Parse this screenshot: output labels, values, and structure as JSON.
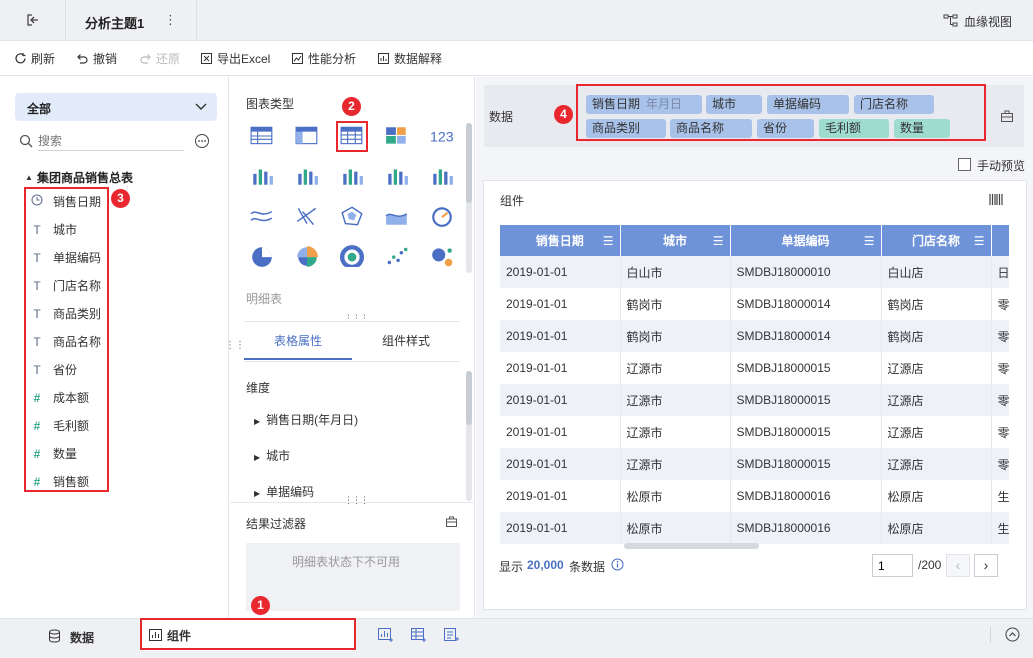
{
  "topbar": {
    "back_icon": "exit-icon",
    "title": "分析主题1",
    "more": "⋮",
    "lineage_label": "血缘视图"
  },
  "toolbar": {
    "refresh": "刷新",
    "undo": "撤销",
    "redo": "还原",
    "export_excel": "导出Excel",
    "perf": "性能分析",
    "explain": "数据解释"
  },
  "left": {
    "dropdown": "全部",
    "search_placeholder": "搜索",
    "table_name": "集团商品销售总表",
    "fields": [
      {
        "label": "销售日期",
        "type": "date"
      },
      {
        "label": "城市",
        "type": "text"
      },
      {
        "label": "单据编码",
        "type": "text"
      },
      {
        "label": "门店名称",
        "type": "text"
      },
      {
        "label": "商品类别",
        "type": "text"
      },
      {
        "label": "商品名称",
        "type": "text"
      },
      {
        "label": "省份",
        "type": "text"
      },
      {
        "label": "成本额",
        "type": "number"
      },
      {
        "label": "毛利额",
        "type": "number"
      },
      {
        "label": "数量",
        "type": "number"
      },
      {
        "label": "销售额",
        "type": "number"
      }
    ]
  },
  "mid": {
    "chart_type_label": "图表类型",
    "detail_table_label": "明细表",
    "tabs": [
      "表格属性",
      "组件样式"
    ],
    "dimension_label": "维度",
    "dims": [
      "销售日期(年月日)",
      "城市",
      "单据编码"
    ],
    "filter_label": "结果过滤器",
    "filter_placeholder": "明细表状态下不可用"
  },
  "right": {
    "data_label": "数据",
    "chips": [
      {
        "label": "销售日期",
        "sub": "年月日",
        "kind": "dim"
      },
      {
        "label": "城市",
        "kind": "dim"
      },
      {
        "label": "单据编码",
        "kind": "dim"
      },
      {
        "label": "门店名称",
        "kind": "dim"
      },
      {
        "label": "商品类别",
        "kind": "dim"
      },
      {
        "label": "商品名称",
        "kind": "dim"
      },
      {
        "label": "省份",
        "kind": "dim"
      },
      {
        "label": "毛利额",
        "kind": "mea"
      },
      {
        "label": "数量",
        "kind": "mea"
      }
    ],
    "manual_preview": "手动预览",
    "component_title": "组件",
    "columns": [
      "销售日期",
      "城市",
      "单据编码",
      "门店名称"
    ],
    "rows": [
      [
        "2019-01-01",
        "白山市",
        "SMDBJ18000010",
        "白山店",
        "日"
      ],
      [
        "2019-01-01",
        "鹤岗市",
        "SMDBJ18000014",
        "鹤岗店",
        "零"
      ],
      [
        "2019-01-01",
        "鹤岗市",
        "SMDBJ18000014",
        "鹤岗店",
        "零"
      ],
      [
        "2019-01-01",
        "辽源市",
        "SMDBJ18000015",
        "辽源店",
        "零"
      ],
      [
        "2019-01-01",
        "辽源市",
        "SMDBJ18000015",
        "辽源店",
        "零"
      ],
      [
        "2019-01-01",
        "辽源市",
        "SMDBJ18000015",
        "辽源店",
        "零"
      ],
      [
        "2019-01-01",
        "辽源市",
        "SMDBJ18000015",
        "辽源店",
        "零"
      ],
      [
        "2019-01-01",
        "松原市",
        "SMDBJ18000016",
        "松原店",
        "生"
      ],
      [
        "2019-01-01",
        "松原市",
        "SMDBJ18000016",
        "松原店",
        "生"
      ]
    ],
    "footer_prefix": "显示",
    "footer_count": "20,000",
    "footer_suffix": "条数据",
    "page_current": "1",
    "page_total": "/200"
  },
  "bottom": {
    "data_tab": "数据",
    "component_tab": "组件"
  },
  "badges": [
    "1",
    "2",
    "3",
    "4"
  ],
  "colors": {
    "accent": "#4a6fc4",
    "header": "#6f93d8",
    "dim_chip": "#a9c2ea",
    "mea_chip": "#9fdcd0",
    "annotation": "#e8272e"
  }
}
